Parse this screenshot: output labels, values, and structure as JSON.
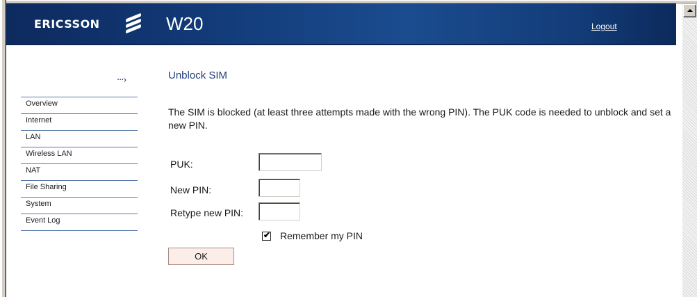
{
  "header": {
    "brand": "ERICSSON",
    "product": "W20",
    "logout_label": "Logout"
  },
  "sidebar": {
    "arrow_glyph": "···›",
    "items": [
      {
        "label": "Overview"
      },
      {
        "label": "Internet"
      },
      {
        "label": "LAN"
      },
      {
        "label": "Wireless LAN"
      },
      {
        "label": "NAT"
      },
      {
        "label": "File Sharing"
      },
      {
        "label": "System"
      },
      {
        "label": "Event Log"
      }
    ]
  },
  "main": {
    "title": "Unblock SIM",
    "description": "The SIM is blocked (at least three attempts made with the wrong PIN). The PUK code is needed to unblock and set a new PIN.",
    "form": {
      "puk_label": "PUK:",
      "puk_value": "",
      "new_pin_label": "New PIN:",
      "new_pin_value": "",
      "retype_pin_label": "Retype new PIN:",
      "retype_pin_value": "",
      "remember_label": "Remember my PIN",
      "remember_checked": true,
      "ok_label": "OK"
    }
  },
  "colors": {
    "header_dark": "#0d2a5e",
    "header_light": "#1b4c8f",
    "title_blue": "#23407a",
    "nav_border": "#5577aa",
    "button_bg": "#fbeee8"
  }
}
